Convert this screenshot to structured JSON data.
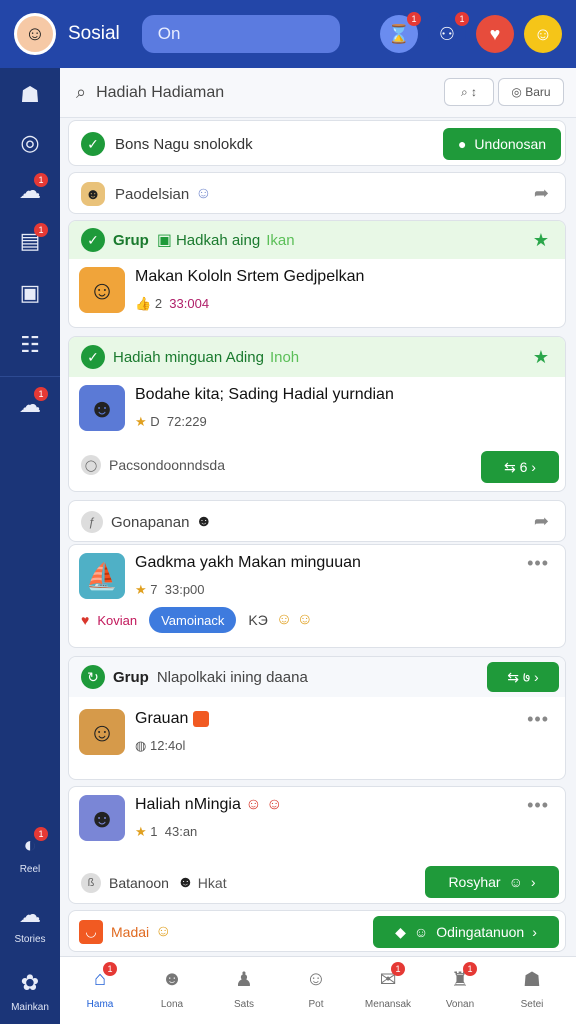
{
  "topbar": {
    "brand": "Sosial",
    "search_text": "On",
    "icons": [
      {
        "name": "hourglass-icon",
        "glyph": "⌛",
        "bg": "#6a8cf0",
        "badge": "1"
      },
      {
        "name": "group-icon",
        "glyph": "⚇",
        "bg": "#2346a8",
        "badge": "1"
      },
      {
        "name": "heart-icon",
        "glyph": "♥",
        "bg": "#e74c3c",
        "badge": ""
      },
      {
        "name": "profile-avatar",
        "glyph": "☺",
        "bg": "#f5c518",
        "badge": ""
      }
    ]
  },
  "sidebar": {
    "items": [
      {
        "name": "sidebar-item-home",
        "glyph": "☗",
        "label": "",
        "badge": ""
      },
      {
        "name": "sidebar-item-discover",
        "glyph": "◎",
        "label": "",
        "badge": ""
      },
      {
        "name": "sidebar-item-groups",
        "glyph": "☁",
        "label": "",
        "badge": "1"
      },
      {
        "name": "sidebar-item-pages",
        "glyph": "▤",
        "label": "",
        "badge": "1"
      },
      {
        "name": "sidebar-item-photos",
        "glyph": "▣",
        "label": "",
        "badge": ""
      },
      {
        "name": "sidebar-item-lists",
        "glyph": "☷",
        "label": "",
        "badge": ""
      },
      {
        "name": "sidebar-item-chat",
        "glyph": "☁",
        "label": "",
        "badge": "1"
      },
      {
        "name": "sidebar-item-reels",
        "glyph": "◐",
        "label": "Reel",
        "badge": "1"
      },
      {
        "name": "sidebar-item-stories",
        "glyph": "☁",
        "label": "Stories",
        "badge": ""
      },
      {
        "name": "sidebar-item-games",
        "glyph": "✿",
        "label": "Mainkan",
        "badge": ""
      }
    ]
  },
  "filterbar": {
    "text": "Hadiah Hadiaman",
    "btn1": "⌕ ↕",
    "btn2": "◎ Baru"
  },
  "feed": {
    "c1": {
      "text": "Bons Nagu snolokdk",
      "button": "Undonosan"
    },
    "c2": {
      "text": "Paodelsian",
      "emoji": "☺"
    },
    "c3": {
      "group": "Grup",
      "group_name": "Hadkah aing",
      "group_tag": "Ikan",
      "title": "Makan Kololn Srtem Gedjpelkan",
      "likes": "2",
      "time": "33:004"
    },
    "c4": {
      "header": "Hadiah minguan Ading",
      "header_tag": "Inoh",
      "title": "Bodahe kita; Sading Hadial yurndian",
      "likes": "D",
      "time": "72:229",
      "footer": "Pacsondoonndsda",
      "button": "⇆ 6 ›"
    },
    "c5": {
      "text": "Gonapanan"
    },
    "c6": {
      "title": "Gadkma yakh Makan minguuan",
      "likes": "7",
      "time": "33:p00",
      "tag": "Kovian",
      "pill": "Vamoinack",
      "extra": "KЭ"
    },
    "c7": {
      "group": "Grup",
      "group_name": "Nlapolkaki ining daana",
      "button": "⇆ ७ ›",
      "title": "Grauan",
      "time": "12:4ol"
    },
    "c8": {
      "title": "Haliah nMingia",
      "likes": "1",
      "time": "43:an",
      "footer": "Batanoon",
      "footer_tag": "Hkat",
      "button": "Rosyhar"
    },
    "c9": {
      "text": "Madai",
      "button": "Odingatanuon"
    }
  },
  "bottomnav": {
    "items": [
      {
        "name": "nav-home",
        "glyph": "⌂",
        "label": "Hama",
        "badge": "1",
        "active": true
      },
      {
        "name": "nav-friends",
        "glyph": "☻",
        "label": "Lona",
        "badge": "",
        "active": false
      },
      {
        "name": "nav-stats",
        "glyph": "♟",
        "label": "Sats",
        "badge": "",
        "active": false
      },
      {
        "name": "nav-profile",
        "glyph": "☺",
        "label": "Pot",
        "badge": "",
        "active": false
      },
      {
        "name": "nav-messages",
        "glyph": "✉",
        "label": "Menansak",
        "badge": "1",
        "active": false
      },
      {
        "name": "nav-notifications",
        "glyph": "♜",
        "label": "Vonan",
        "badge": "1",
        "active": false
      },
      {
        "name": "nav-settings",
        "glyph": "☗",
        "label": "Setei",
        "badge": "",
        "active": false
      }
    ]
  },
  "colors": {
    "primary": "#2346a8",
    "sidebar": "#1b3578",
    "green": "#1f9a3a",
    "pill": "#3e7bde"
  }
}
